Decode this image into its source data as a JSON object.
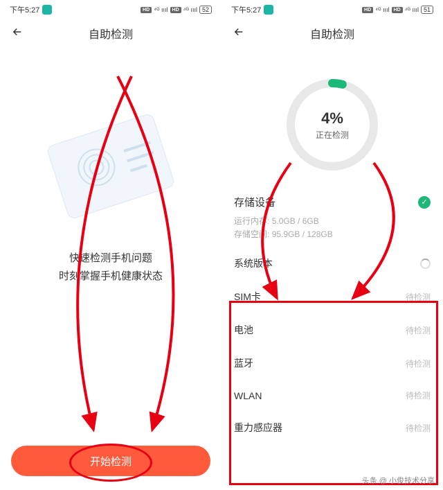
{
  "status": {
    "time": "下午5:27",
    "battery_left": "52",
    "battery_right": "51"
  },
  "header": {
    "title": "自助检测"
  },
  "left": {
    "desc_line1": "快速检测手机问题",
    "desc_line2": "时刻掌握手机健康状态",
    "start_button": "开始检测"
  },
  "right": {
    "progress_percent": "4%",
    "progress_label": "正在检测",
    "storage": {
      "title": "存储设备",
      "ram_label": "运行内存:",
      "ram_value": "5.0GB / 6GB",
      "rom_label": "存储空间:",
      "rom_value": "95.9GB / 128GB"
    },
    "items": [
      {
        "label": "系统版本",
        "status": ""
      },
      {
        "label": "SIM卡",
        "status": "待检测"
      },
      {
        "label": "电池",
        "status": "待检测"
      },
      {
        "label": "蓝牙",
        "status": "待检测"
      },
      {
        "label": "WLAN",
        "status": "待检测"
      },
      {
        "label": "重力感应器",
        "status": "待检测"
      }
    ]
  },
  "watermark": "头条 @ 小俊技术分享"
}
